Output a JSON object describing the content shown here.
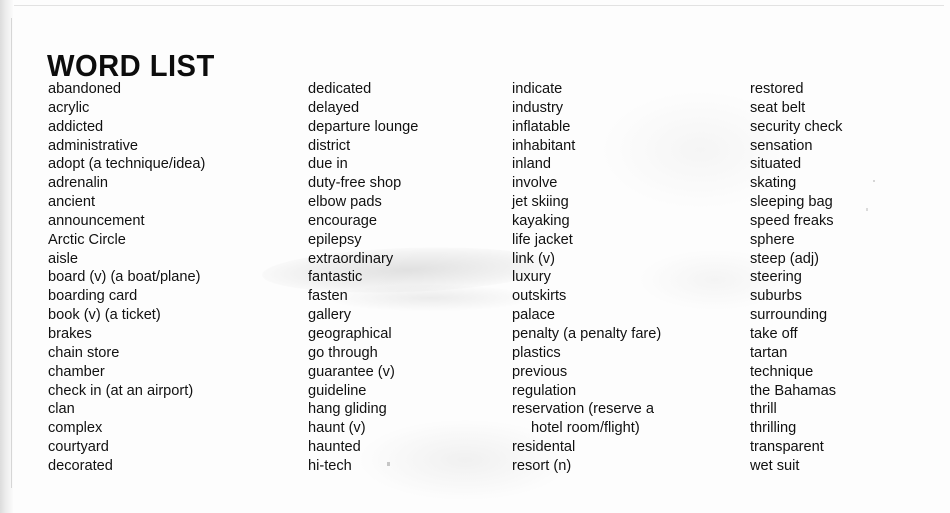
{
  "page": {
    "title": "WORD LIST"
  },
  "columns": [
    {
      "id": "column-1",
      "entries": [
        {
          "text": "abandoned"
        },
        {
          "text": "acrylic"
        },
        {
          "text": "addicted"
        },
        {
          "text": "administrative"
        },
        {
          "text": "adopt (a technique/idea)"
        },
        {
          "text": "adrenalin"
        },
        {
          "text": "ancient"
        },
        {
          "text": "announcement"
        },
        {
          "text": "Arctic Circle"
        },
        {
          "text": "aisle"
        },
        {
          "text": "board (v) (a boat/plane)"
        },
        {
          "text": "boarding card"
        },
        {
          "text": "book (v) (a ticket)"
        },
        {
          "text": "brakes"
        },
        {
          "text": "chain store"
        },
        {
          "text": "chamber"
        },
        {
          "text": "check in (at an airport)"
        },
        {
          "text": "clan"
        },
        {
          "text": "complex"
        },
        {
          "text": "courtyard"
        },
        {
          "text": "decorated"
        }
      ]
    },
    {
      "id": "column-2",
      "entries": [
        {
          "text": "dedicated"
        },
        {
          "text": "delayed"
        },
        {
          "text": "departure lounge"
        },
        {
          "text": "district"
        },
        {
          "text": "due in"
        },
        {
          "text": "duty-free shop"
        },
        {
          "text": "elbow pads"
        },
        {
          "text": "encourage"
        },
        {
          "text": "epilepsy"
        },
        {
          "text": "extraordinary"
        },
        {
          "text": "fantastic"
        },
        {
          "text": "fasten"
        },
        {
          "text": "gallery"
        },
        {
          "text": "geographical"
        },
        {
          "text": "go through"
        },
        {
          "text": "guarantee (v)"
        },
        {
          "text": "guideline"
        },
        {
          "text": "hang gliding"
        },
        {
          "text": "haunt (v)"
        },
        {
          "text": "haunted"
        },
        {
          "text": "hi-tech"
        }
      ]
    },
    {
      "id": "column-3",
      "entries": [
        {
          "text": "indicate"
        },
        {
          "text": "industry"
        },
        {
          "text": "inflatable"
        },
        {
          "text": "inhabitant"
        },
        {
          "text": "inland"
        },
        {
          "text": "involve"
        },
        {
          "text": "jet skiing"
        },
        {
          "text": "kayaking"
        },
        {
          "text": "life jacket"
        },
        {
          "text": "link (v)"
        },
        {
          "text": "luxury"
        },
        {
          "text": "outskirts"
        },
        {
          "text": "palace"
        },
        {
          "text": "penalty (a penalty fare)"
        },
        {
          "text": "plastics"
        },
        {
          "text": "previous"
        },
        {
          "text": "regulation"
        },
        {
          "text": "reservation (reserve a"
        },
        {
          "text": "hotel room/flight)",
          "continuation": true
        },
        {
          "text": "residental"
        },
        {
          "text": "resort (n)"
        }
      ]
    },
    {
      "id": "column-4",
      "entries": [
        {
          "text": "restored"
        },
        {
          "text": "seat belt"
        },
        {
          "text": "security check"
        },
        {
          "text": "sensation"
        },
        {
          "text": "situated"
        },
        {
          "text": "skating"
        },
        {
          "text": "sleeping bag"
        },
        {
          "text": "speed freaks"
        },
        {
          "text": "sphere"
        },
        {
          "text": "steep (adj)"
        },
        {
          "text": "steering"
        },
        {
          "text": "suburbs"
        },
        {
          "text": "surrounding"
        },
        {
          "text": "take off"
        },
        {
          "text": "tartan"
        },
        {
          "text": "technique"
        },
        {
          "text": "the Bahamas"
        },
        {
          "text": "thrill"
        },
        {
          "text": "thrilling"
        },
        {
          "text": "transparent"
        },
        {
          "text": "wet suit"
        }
      ]
    }
  ]
}
